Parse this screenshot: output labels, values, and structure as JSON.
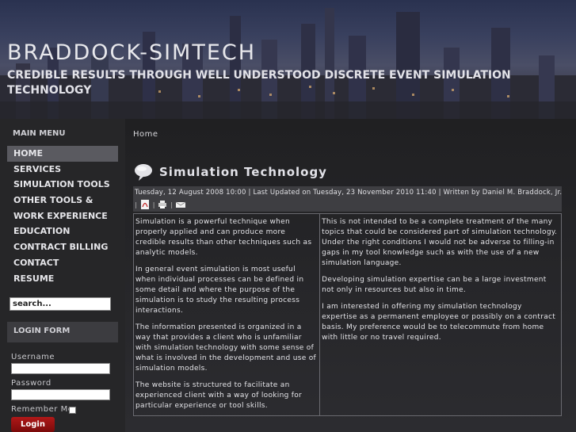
{
  "header": {
    "site_title": "BRADDOCK-SIMTECH",
    "tagline": "CREDIBLE RESULTS THROUGH WELL UNDERSTOOD DISCRETE EVENT SIMULATION TECHNOLOGY"
  },
  "sidebar": {
    "menu_heading": "MAIN MENU",
    "items": [
      {
        "label": "HOME",
        "active": true
      },
      {
        "label": "SERVICES"
      },
      {
        "label": "SIMULATION TOOLS"
      },
      {
        "label": "OTHER TOOLS &"
      },
      {
        "label": "WORK EXPERIENCE"
      },
      {
        "label": "EDUCATION"
      },
      {
        "label": "CONTRACT BILLING"
      },
      {
        "label": "CONTACT"
      },
      {
        "label": "RESUME"
      }
    ],
    "search_value": "search...",
    "login_heading": "LOGIN FORM",
    "username_label": "Username",
    "password_label": "Password",
    "remember_label": "Remember Me",
    "login_button": "Login"
  },
  "main": {
    "breadcrumb": "Home",
    "title": "Simulation Technology",
    "meta": "Tuesday, 12 August 2008 10:00 | Last Updated on Tuesday, 23 November 2010 11:40 | Written by Daniel M. Braddock, Jr.",
    "left_paragraphs": [
      "Simulation is a powerful technique when properly applied and can produce more credible results than other techniques such as analytic models.",
      "In general event simulation is most useful when individual processes can be defined in some detail and where the purpose of the simulation is to study the resulting process interactions.",
      "The information presented is organized in a way that provides a client who is unfamiliar with simulation technology with some sense of what is involved in the development and use of simulation models.",
      "The website is structured to facilitate an experienced client with a way of looking for particular experience or tool skills."
    ],
    "right_paragraphs": [
      "This is not intended to be a complete treatment of the many topics that could be considered part of simulation technology. Under the right conditions I would not be adverse to filling-in gaps in my tool knowledge such as with the use of a new simulation language.",
      "Developing simulation expertise can be a large investment not only in resources but also in time.",
      "I am interested in offering my simulation technology expertise as a permanent employee or possibly on a contract basis. My preference would be to telecommute from home with little or no travel required."
    ]
  }
}
